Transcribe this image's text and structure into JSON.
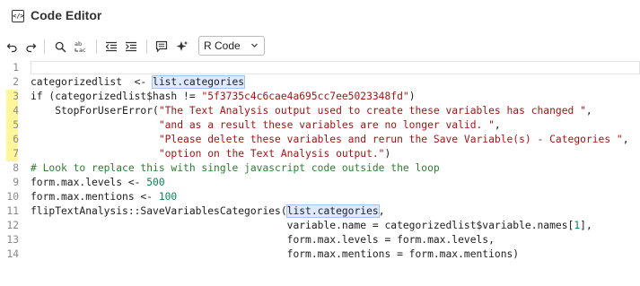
{
  "app": {
    "title": "Code Editor"
  },
  "toolbar": {
    "buttons": [
      {
        "name": "undo"
      },
      {
        "name": "redo"
      },
      {
        "name": "search"
      },
      {
        "name": "replace"
      },
      {
        "name": "outdent"
      },
      {
        "name": "indent"
      },
      {
        "name": "comment"
      },
      {
        "name": "ai-assist"
      }
    ],
    "language": "R Code"
  },
  "editor": {
    "line_numbers": [
      "1",
      "2",
      "3",
      "4",
      "5",
      "6",
      "7",
      "8",
      "9",
      "10",
      "11",
      "12",
      "13",
      "14"
    ],
    "highlighted_lines": [
      3,
      4,
      5,
      6,
      7
    ],
    "lines": [
      [],
      [
        {
          "t": "categorizedlist  <- ",
          "c": "plain"
        },
        {
          "t": "list.categories",
          "c": "sel"
        }
      ],
      [
        {
          "t": "if (categorizedlist$hash != ",
          "c": "plain"
        },
        {
          "t": "\"5f3735c4c6cae4a695cc7ee5023348fd\"",
          "c": "str"
        },
        {
          "t": ")",
          "c": "plain"
        }
      ],
      [
        {
          "t": "    StopForUserError(",
          "c": "plain"
        },
        {
          "t": "\"The Text Analysis output used to create these variables has changed \"",
          "c": "str"
        },
        {
          "t": ",",
          "c": "plain"
        }
      ],
      [
        {
          "t": "                     ",
          "c": "plain"
        },
        {
          "t": "\"and as a result these variables are no longer valid. \"",
          "c": "str"
        },
        {
          "t": ",",
          "c": "plain"
        }
      ],
      [
        {
          "t": "                     ",
          "c": "plain"
        },
        {
          "t": "\"Please delete these variables and rerun the Save Variable(s) - Categories \"",
          "c": "str"
        },
        {
          "t": ",",
          "c": "plain"
        }
      ],
      [
        {
          "t": "                     ",
          "c": "plain"
        },
        {
          "t": "\"option on the Text Analysis output.\"",
          "c": "str"
        },
        {
          "t": ")",
          "c": "plain"
        }
      ],
      [
        {
          "t": "# Look to replace this with single javascript code outside the loop",
          "c": "comment"
        }
      ],
      [
        {
          "t": "form.max.levels <- ",
          "c": "plain"
        },
        {
          "t": "500",
          "c": "num"
        }
      ],
      [
        {
          "t": "form.max.mentions <- ",
          "c": "plain"
        },
        {
          "t": "100",
          "c": "num"
        }
      ],
      [
        {
          "t": "flipTextAnalysis::SaveVariablesCategories(",
          "c": "plain"
        },
        {
          "t": "list.categories",
          "c": "sel"
        },
        {
          "t": ",",
          "c": "plain"
        }
      ],
      [
        {
          "t": "                                          variable.name = categorizedlist$variable.names[",
          "c": "plain"
        },
        {
          "t": "1",
          "c": "num"
        },
        {
          "t": "],",
          "c": "plain"
        }
      ],
      [
        {
          "t": "                                          form.max.levels = form.max.levels,",
          "c": "plain"
        }
      ],
      [
        {
          "t": "                                          form.max.mentions = form.max.mentions)",
          "c": "plain"
        }
      ]
    ]
  }
}
